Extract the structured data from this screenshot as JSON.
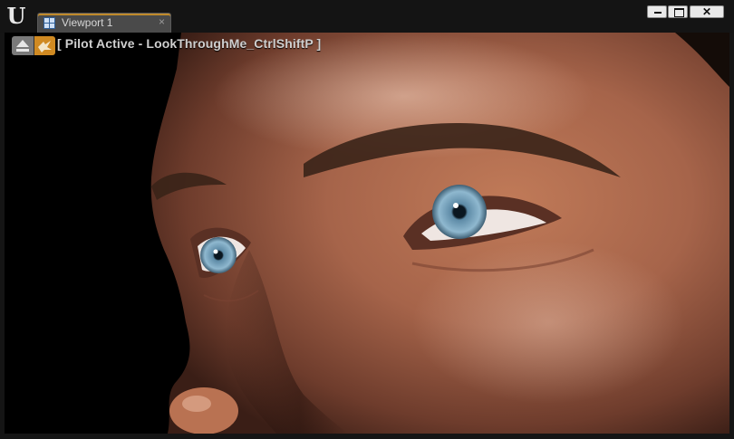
{
  "app": {
    "logo_glyph": "U",
    "window_buttons": {
      "minimize_icon": "minimize-icon",
      "maximize_icon": "maximize-icon",
      "close_glyph": "✕"
    }
  },
  "tabs": [
    {
      "label": "Viewport 1",
      "icon": "viewport-grid-icon",
      "close_glyph": "×",
      "active": true
    }
  ],
  "viewport": {
    "toolbar": {
      "eject_icon": "eject-icon",
      "pilot_icon": "pilot-camera-icon"
    },
    "pilot_status": "[ Pilot Active - LookThroughMe_CtrlShiftP ]",
    "scene": "close-up render of a man's face with blue eyes"
  },
  "colors": {
    "accent": "#d08a22",
    "tab_bg": "#4a4a4a",
    "titlebar_bg": "#141414",
    "viewport_bg": "#000000",
    "skin": "#a8674a"
  }
}
